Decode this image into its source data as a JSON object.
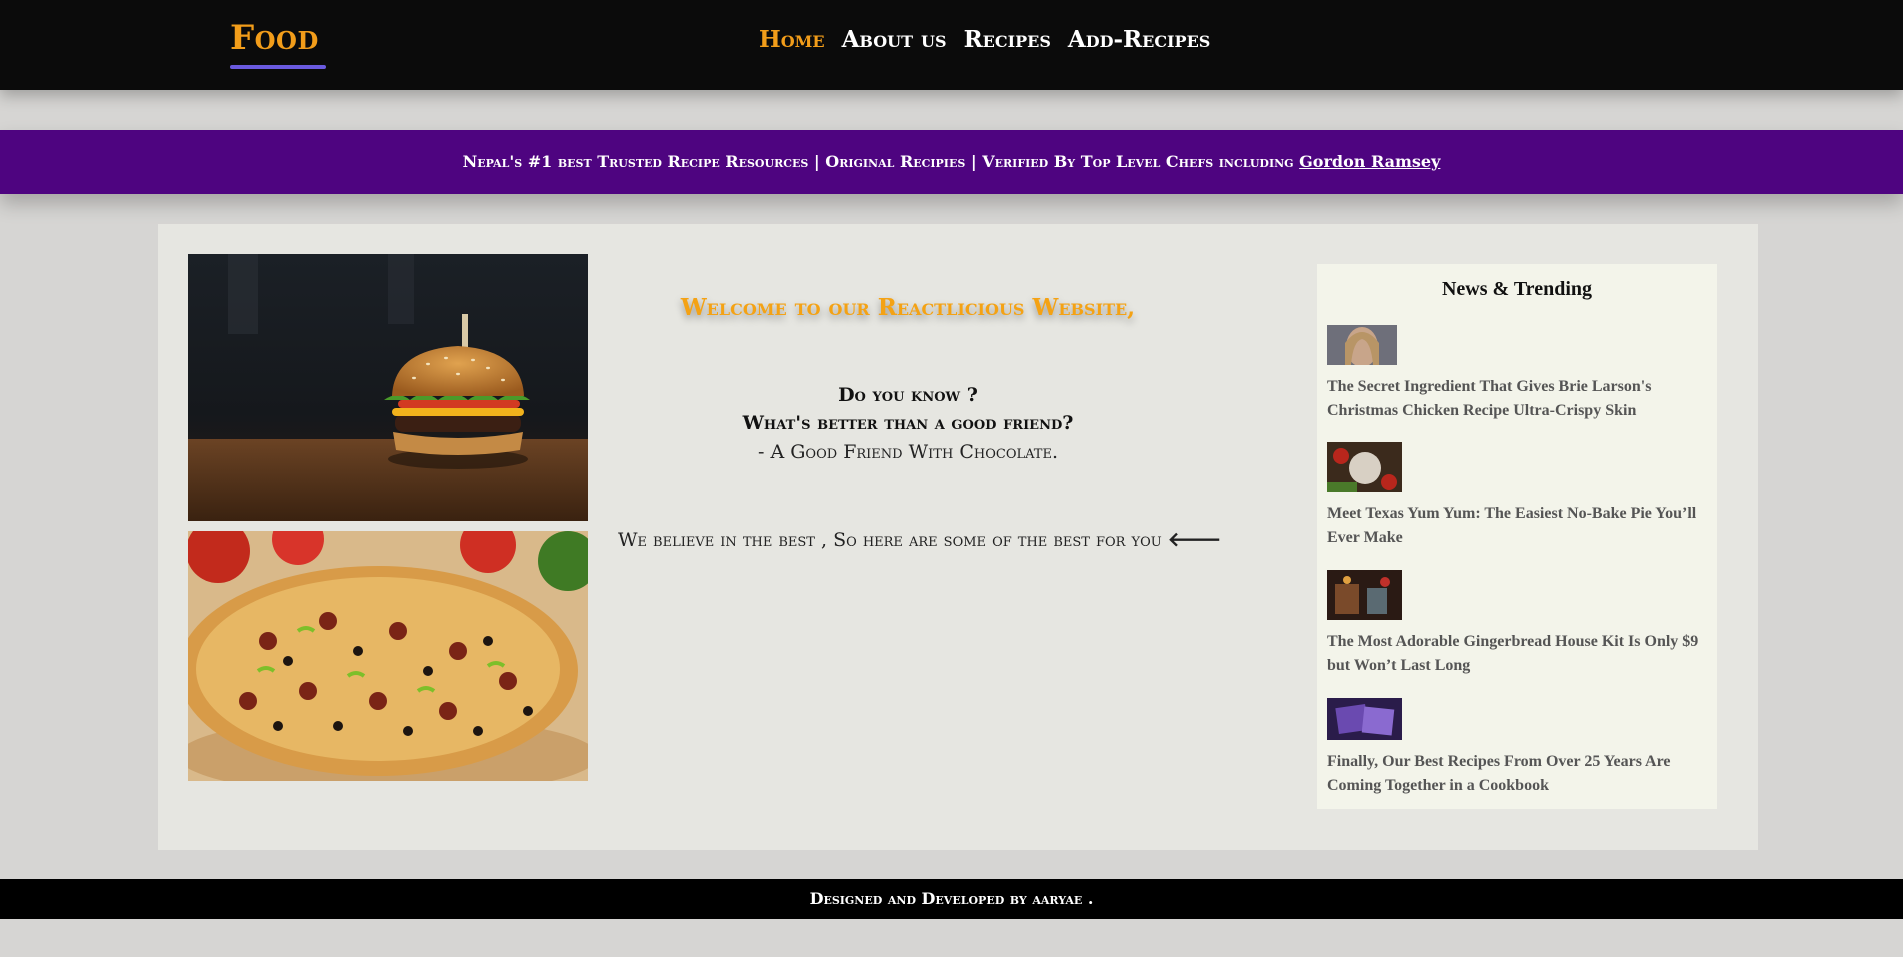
{
  "header": {
    "logo": "Food",
    "nav": [
      "Home",
      "About us",
      "Recipes",
      "Add-Recipes"
    ]
  },
  "banner": {
    "text": "Nepal's #1 best Trusted Recipe Resources | Original Recipies | Verified By Top Level Chefs including ",
    "link": "Gordon Ramsey "
  },
  "main": {
    "images": [
      "burger-photo",
      "pizza-photo"
    ],
    "welcome": "Welcome to our Reactlicious Website,",
    "question1": "Do you know ?",
    "question2": "What's better than a good friend?",
    "answer": "- A Good Friend With Chocolate.",
    "believe": "We believe in the best , So here are some of the best for you ",
    "arrow": "🡐"
  },
  "news": {
    "title": "News & Trending",
    "items": [
      "The Secret Ingredient That Gives Brie Larson's Christmas Chicken Recipe Ultra-Crispy Skin",
      "Meet Texas Yum Yum: The Easiest No-Bake Pie You’ll Ever Make",
      "The Most Adorable Gingerbread House Kit Is Only $9 but Won’t Last Long",
      "Finally, Our Best Recipes From Over 25 Years Are Coming Together in a Cookbook"
    ]
  },
  "footer": {
    "text": "Designed and Developed by aaryae ."
  },
  "colors": {
    "accent": "#f29d1a",
    "banner": "#4e0480",
    "underline": "#6a5adf"
  }
}
